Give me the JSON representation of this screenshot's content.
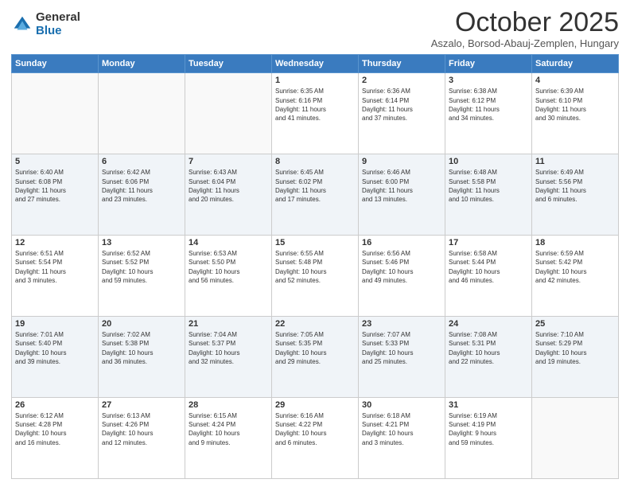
{
  "logo": {
    "general": "General",
    "blue": "Blue"
  },
  "header": {
    "month": "October 2025",
    "location": "Aszalo, Borsod-Abauj-Zemplen, Hungary"
  },
  "weekdays": [
    "Sunday",
    "Monday",
    "Tuesday",
    "Wednesday",
    "Thursday",
    "Friday",
    "Saturday"
  ],
  "weeks": [
    [
      {
        "day": "",
        "info": ""
      },
      {
        "day": "",
        "info": ""
      },
      {
        "day": "",
        "info": ""
      },
      {
        "day": "1",
        "info": "Sunrise: 6:35 AM\nSunset: 6:16 PM\nDaylight: 11 hours\nand 41 minutes."
      },
      {
        "day": "2",
        "info": "Sunrise: 6:36 AM\nSunset: 6:14 PM\nDaylight: 11 hours\nand 37 minutes."
      },
      {
        "day": "3",
        "info": "Sunrise: 6:38 AM\nSunset: 6:12 PM\nDaylight: 11 hours\nand 34 minutes."
      },
      {
        "day": "4",
        "info": "Sunrise: 6:39 AM\nSunset: 6:10 PM\nDaylight: 11 hours\nand 30 minutes."
      }
    ],
    [
      {
        "day": "5",
        "info": "Sunrise: 6:40 AM\nSunset: 6:08 PM\nDaylight: 11 hours\nand 27 minutes."
      },
      {
        "day": "6",
        "info": "Sunrise: 6:42 AM\nSunset: 6:06 PM\nDaylight: 11 hours\nand 23 minutes."
      },
      {
        "day": "7",
        "info": "Sunrise: 6:43 AM\nSunset: 6:04 PM\nDaylight: 11 hours\nand 20 minutes."
      },
      {
        "day": "8",
        "info": "Sunrise: 6:45 AM\nSunset: 6:02 PM\nDaylight: 11 hours\nand 17 minutes."
      },
      {
        "day": "9",
        "info": "Sunrise: 6:46 AM\nSunset: 6:00 PM\nDaylight: 11 hours\nand 13 minutes."
      },
      {
        "day": "10",
        "info": "Sunrise: 6:48 AM\nSunset: 5:58 PM\nDaylight: 11 hours\nand 10 minutes."
      },
      {
        "day": "11",
        "info": "Sunrise: 6:49 AM\nSunset: 5:56 PM\nDaylight: 11 hours\nand 6 minutes."
      }
    ],
    [
      {
        "day": "12",
        "info": "Sunrise: 6:51 AM\nSunset: 5:54 PM\nDaylight: 11 hours\nand 3 minutes."
      },
      {
        "day": "13",
        "info": "Sunrise: 6:52 AM\nSunset: 5:52 PM\nDaylight: 10 hours\nand 59 minutes."
      },
      {
        "day": "14",
        "info": "Sunrise: 6:53 AM\nSunset: 5:50 PM\nDaylight: 10 hours\nand 56 minutes."
      },
      {
        "day": "15",
        "info": "Sunrise: 6:55 AM\nSunset: 5:48 PM\nDaylight: 10 hours\nand 52 minutes."
      },
      {
        "day": "16",
        "info": "Sunrise: 6:56 AM\nSunset: 5:46 PM\nDaylight: 10 hours\nand 49 minutes."
      },
      {
        "day": "17",
        "info": "Sunrise: 6:58 AM\nSunset: 5:44 PM\nDaylight: 10 hours\nand 46 minutes."
      },
      {
        "day": "18",
        "info": "Sunrise: 6:59 AM\nSunset: 5:42 PM\nDaylight: 10 hours\nand 42 minutes."
      }
    ],
    [
      {
        "day": "19",
        "info": "Sunrise: 7:01 AM\nSunset: 5:40 PM\nDaylight: 10 hours\nand 39 minutes."
      },
      {
        "day": "20",
        "info": "Sunrise: 7:02 AM\nSunset: 5:38 PM\nDaylight: 10 hours\nand 36 minutes."
      },
      {
        "day": "21",
        "info": "Sunrise: 7:04 AM\nSunset: 5:37 PM\nDaylight: 10 hours\nand 32 minutes."
      },
      {
        "day": "22",
        "info": "Sunrise: 7:05 AM\nSunset: 5:35 PM\nDaylight: 10 hours\nand 29 minutes."
      },
      {
        "day": "23",
        "info": "Sunrise: 7:07 AM\nSunset: 5:33 PM\nDaylight: 10 hours\nand 25 minutes."
      },
      {
        "day": "24",
        "info": "Sunrise: 7:08 AM\nSunset: 5:31 PM\nDaylight: 10 hours\nand 22 minutes."
      },
      {
        "day": "25",
        "info": "Sunrise: 7:10 AM\nSunset: 5:29 PM\nDaylight: 10 hours\nand 19 minutes."
      }
    ],
    [
      {
        "day": "26",
        "info": "Sunrise: 6:12 AM\nSunset: 4:28 PM\nDaylight: 10 hours\nand 16 minutes."
      },
      {
        "day": "27",
        "info": "Sunrise: 6:13 AM\nSunset: 4:26 PM\nDaylight: 10 hours\nand 12 minutes."
      },
      {
        "day": "28",
        "info": "Sunrise: 6:15 AM\nSunset: 4:24 PM\nDaylight: 10 hours\nand 9 minutes."
      },
      {
        "day": "29",
        "info": "Sunrise: 6:16 AM\nSunset: 4:22 PM\nDaylight: 10 hours\nand 6 minutes."
      },
      {
        "day": "30",
        "info": "Sunrise: 6:18 AM\nSunset: 4:21 PM\nDaylight: 10 hours\nand 3 minutes."
      },
      {
        "day": "31",
        "info": "Sunrise: 6:19 AM\nSunset: 4:19 PM\nDaylight: 9 hours\nand 59 minutes."
      },
      {
        "day": "",
        "info": ""
      }
    ]
  ]
}
